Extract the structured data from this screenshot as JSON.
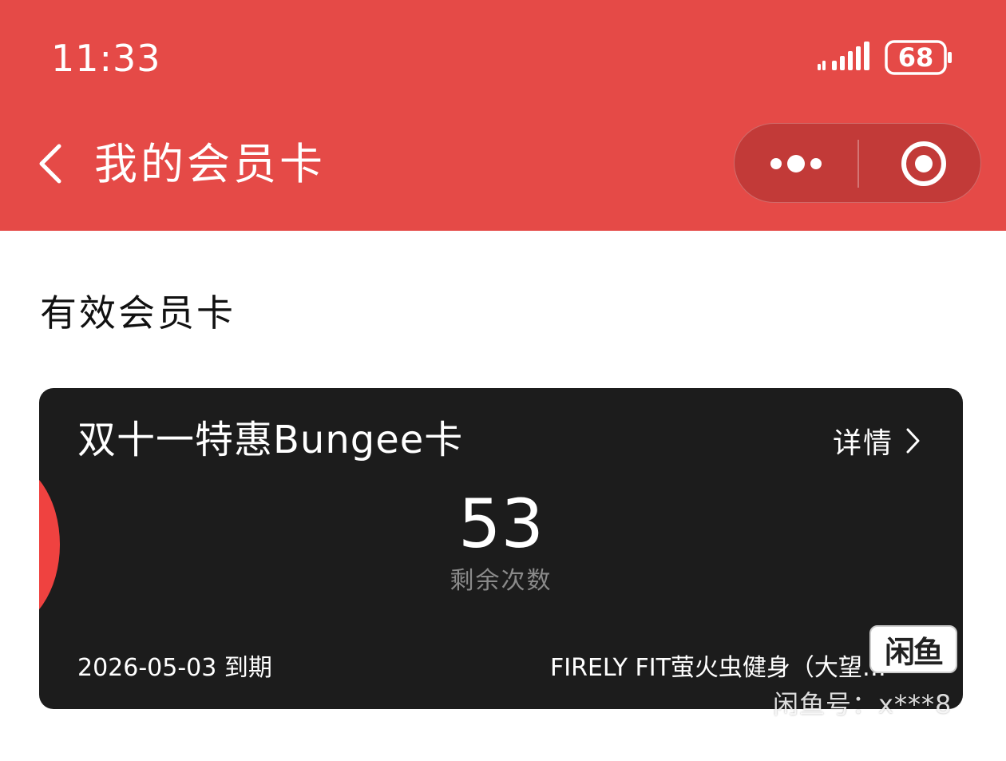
{
  "status_bar": {
    "time": "11:33",
    "battery": "68",
    "icons": [
      "signal-icon",
      "battery-icon"
    ]
  },
  "nav": {
    "back_icon": "chevron-left-icon",
    "title": "我的会员卡",
    "capsule": {
      "more_icon": "more-dots-icon",
      "close_icon": "target-circle-icon"
    }
  },
  "section": {
    "title": "有效会员卡"
  },
  "card": {
    "title": "双十一特惠Bungee卡",
    "detail_label": "详情",
    "detail_icon": "chevron-right-icon",
    "remaining_count": "53",
    "remaining_label": "剩余次数",
    "expiry": "2026-05-03 到期",
    "store": "FIRELY FIT萤火虫健身（大望…"
  },
  "watermark": {
    "logo_text": "闲鱼",
    "text": "闲鱼号：x***8"
  },
  "colors": {
    "header_bg": "#e54a47",
    "capsule_bg": "#c23a38",
    "card_bg": "#1c1c1c",
    "card_accent": "#ef4240",
    "count_label": "#8a8a8a"
  }
}
